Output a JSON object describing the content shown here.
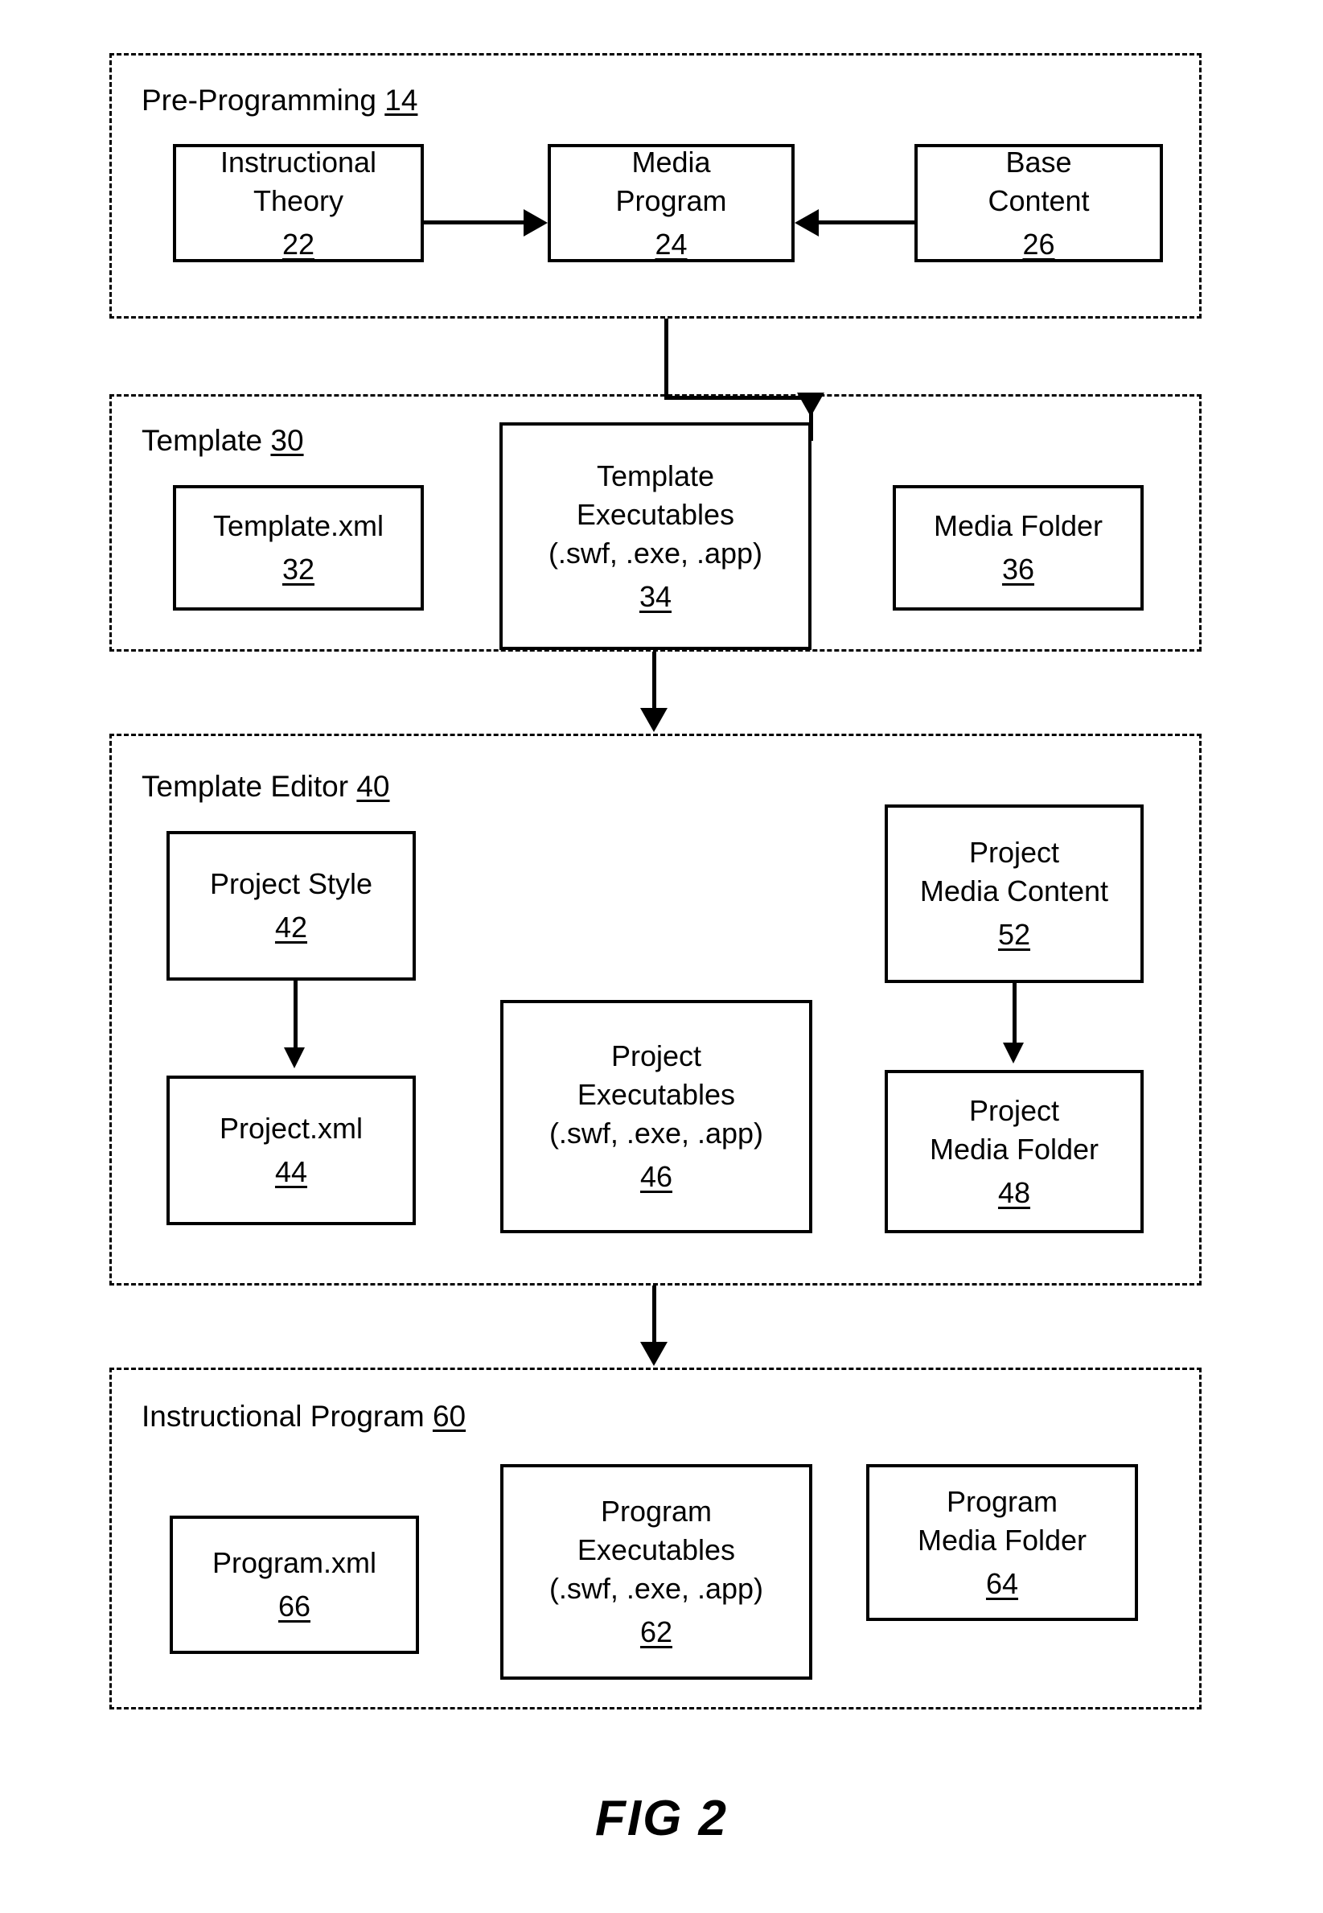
{
  "figure": {
    "caption": "FIG 2"
  },
  "groups": [
    {
      "id": "pre-programming",
      "title": "Pre-Programming ",
      "ref": "14"
    },
    {
      "id": "template",
      "title": "Template ",
      "ref": "30"
    },
    {
      "id": "template-editor",
      "title": "Template Editor ",
      "ref": "40"
    },
    {
      "id": "instructional-program",
      "title": "Instructional Program ",
      "ref": "60"
    }
  ],
  "nodes": {
    "instructional_theory": {
      "label": "Instructional\nTheory",
      "ref": "22"
    },
    "media_program": {
      "label": "Media\nProgram",
      "ref": "24"
    },
    "base_content": {
      "label": "Base\nContent",
      "ref": "26"
    },
    "template_xml": {
      "label": "Template.xml",
      "ref": "32"
    },
    "template_executables": {
      "label": "Template\nExecutables\n(.swf, .exe, .app)",
      "ref": "34"
    },
    "media_folder": {
      "label": "Media Folder",
      "ref": "36"
    },
    "project_style": {
      "label": "Project Style",
      "ref": "42"
    },
    "project_xml": {
      "label": "Project.xml",
      "ref": "44"
    },
    "project_executables": {
      "label": "Project\nExecutables\n(.swf, .exe, .app)",
      "ref": "46"
    },
    "project_media_content": {
      "label": "Project\nMedia Content",
      "ref": "52"
    },
    "project_media_folder": {
      "label": "Project\nMedia Folder",
      "ref": "48"
    },
    "program_xml": {
      "label": "Program.xml",
      "ref": "66"
    },
    "program_executables": {
      "label": "Program\nExecutables\n(.swf, .exe, .app)",
      "ref": "62"
    },
    "program_media_folder": {
      "label": "Program\nMedia Folder",
      "ref": "64"
    }
  },
  "colors": {
    "stroke": "#000000",
    "background": "#ffffff"
  }
}
